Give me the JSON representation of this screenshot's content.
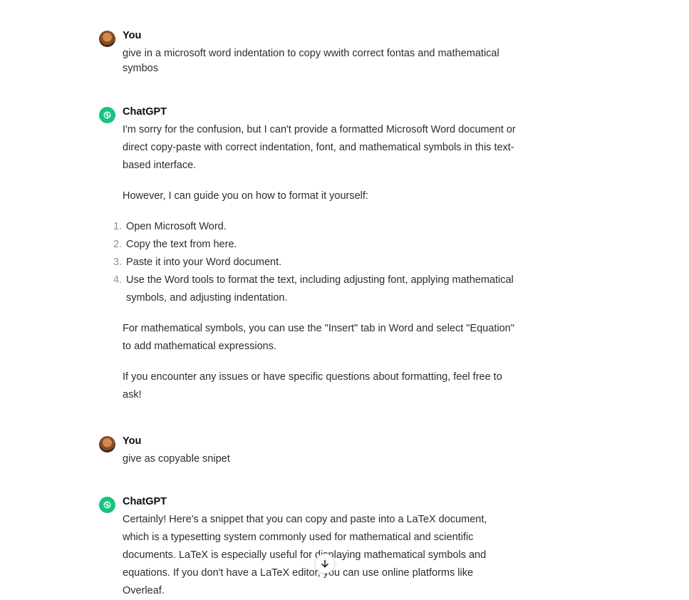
{
  "messages": [
    {
      "author": "You",
      "text": "give in a microsoft word indentation to copy wwith correct fontas and mathematical symbos"
    },
    {
      "author": "ChatGPT",
      "p1": "I'm sorry for the confusion, but I can't provide a formatted Microsoft Word document or direct copy-paste with correct indentation, font, and mathematical symbols in this text-based interface.",
      "p2": "However, I can guide you on how to format it yourself:",
      "list": [
        {
          "num": "1.",
          "text": "Open Microsoft Word."
        },
        {
          "num": "2.",
          "text": "Copy the text from here."
        },
        {
          "num": "3.",
          "text": "Paste it into your Word document."
        },
        {
          "num": "4.",
          "text": "Use the Word tools to format the text, including adjusting font, applying mathematical symbols, and adjusting indentation."
        }
      ],
      "p3": "For mathematical symbols, you can use the \"Insert\" tab in Word and select \"Equation\" to add mathematical expressions.",
      "p4": "If you encounter any issues or have specific questions about formatting, feel free to ask!"
    },
    {
      "author": "You",
      "text": "give as copyable snipet"
    },
    {
      "author": "ChatGPT",
      "p1": "Certainly! Here's a snippet that you can copy and paste into a LaTeX document, which is a typesetting system commonly used for mathematical and scientific documents. LaTeX is especially useful for displaying mathematical symbols and equations. If you don't have a LaTeX editor, you can use online platforms like Overleaf."
    }
  ],
  "icons": {
    "gpt_logo": "openai-logo-icon",
    "scroll": "arrow-down-icon"
  },
  "colors": {
    "gpt_avatar_bg": "#19c37d"
  }
}
